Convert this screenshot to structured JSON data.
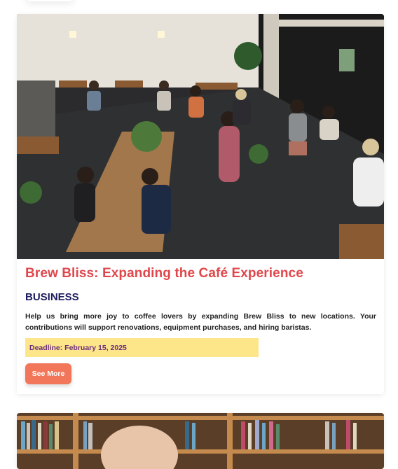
{
  "campaigns": [
    {
      "title": "Brew Bliss: Expanding the Café Experience",
      "category": "BUSINESS",
      "description": "Help us bring more joy to coffee lovers by expanding Brew Bliss to new locations. Your contributions will support renovations, equipment purchases, and hiring baristas.",
      "deadline": "Deadline: February 15, 2025",
      "button_label": "See More"
    }
  ],
  "colors": {
    "title": "#e0474c",
    "category": "#1c1c5e",
    "deadline_bg": "#fde68a",
    "deadline_text": "#6b2a7d",
    "button_bg": "#f2765a"
  }
}
